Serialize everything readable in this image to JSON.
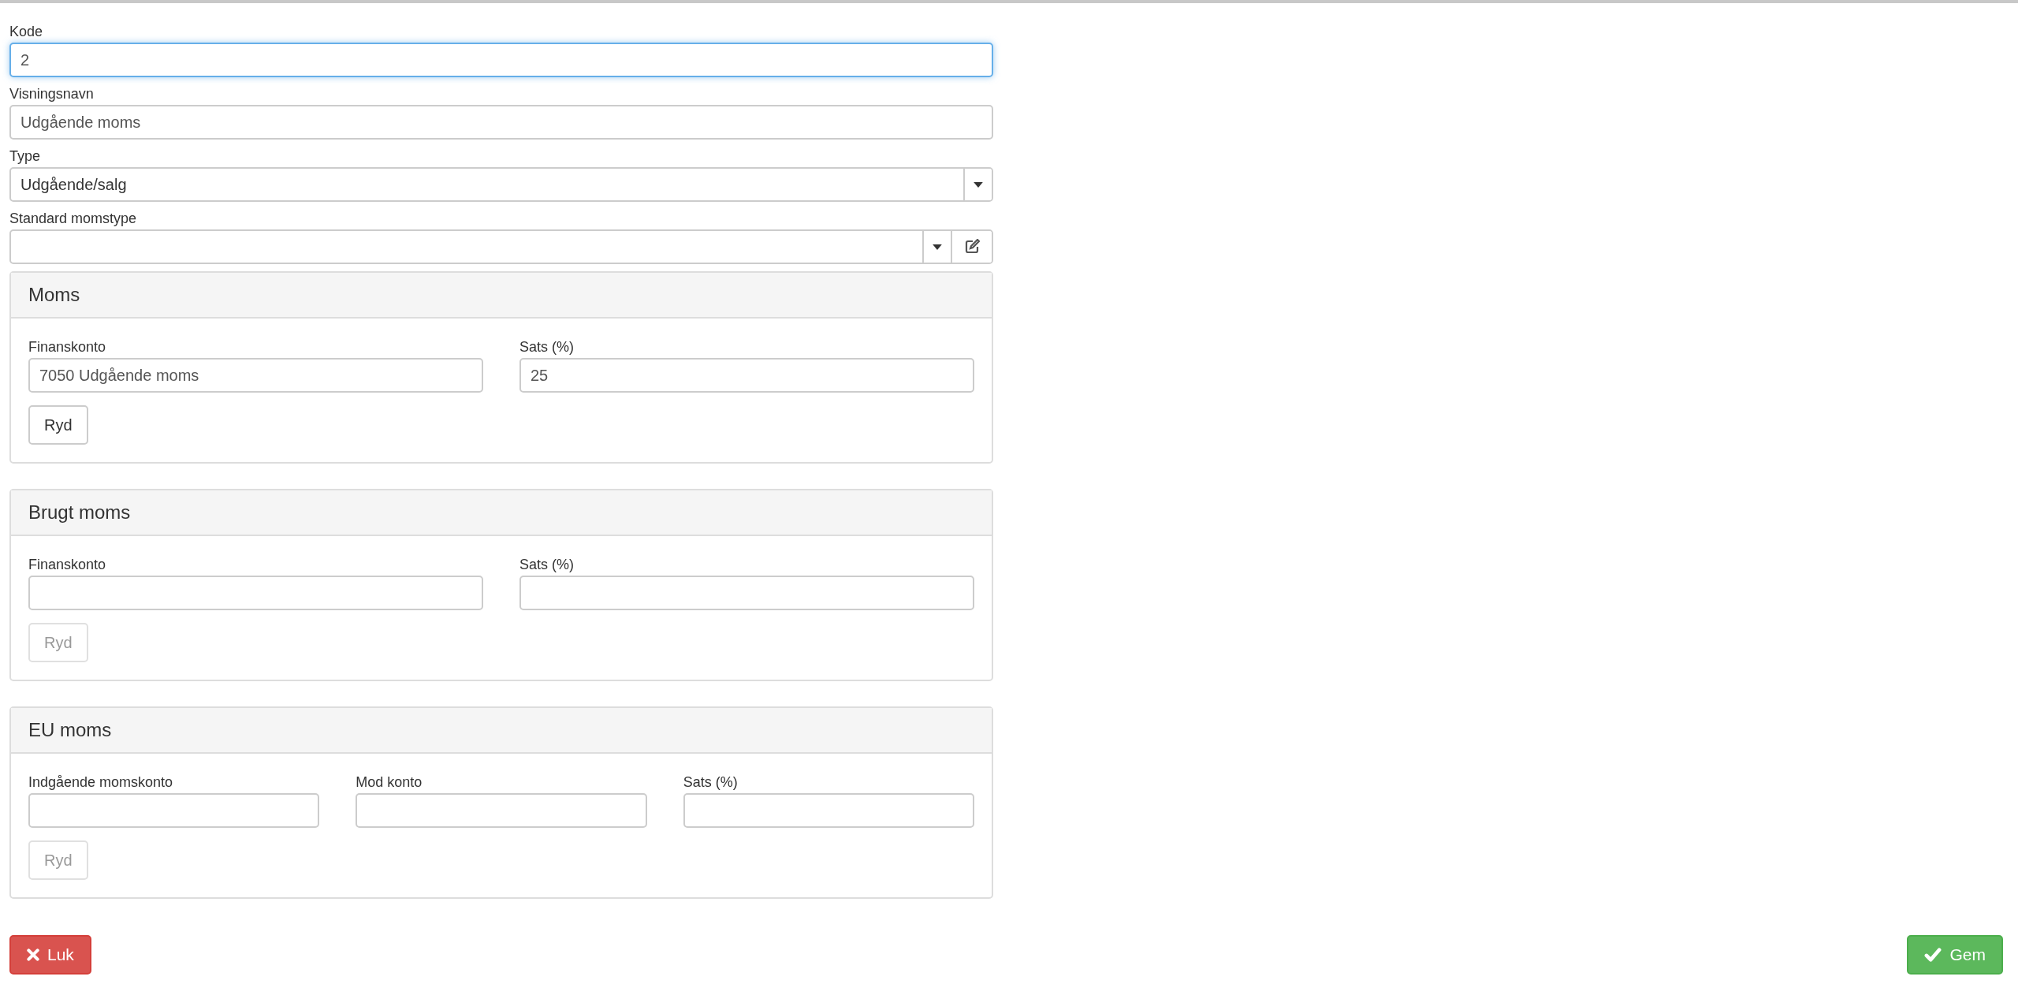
{
  "fields": [
    {
      "kind": "text",
      "label": "Kode",
      "value": "2",
      "focused": true
    },
    {
      "kind": "text",
      "label": "Visningsnavn",
      "value": "Udgående moms",
      "focused": false
    },
    {
      "kind": "select",
      "label": "Type",
      "value": "Udgående/salg",
      "focused": false
    },
    {
      "kind": "select-edit",
      "label": "Standard momstype",
      "focused": false
    }
  ],
  "panels": [
    {
      "title": "Moms",
      "fields": [
        {
          "label": "Finanskonto",
          "value": "7050 Udgående moms"
        },
        {
          "label": "Sats (%)",
          "value": "25"
        }
      ],
      "clear_button": {
        "label": "Ryd",
        "disabled": false
      }
    },
    {
      "title": "Brugt moms",
      "fields": [
        {
          "label": "Finanskonto"
        },
        {
          "label": "Sats (%)"
        }
      ],
      "clear_button": {
        "label": "Ryd",
        "disabled": true
      }
    },
    {
      "title": "EU moms",
      "fields": [
        {
          "label": "Indgående momskonto"
        },
        {
          "label": "Mod konto"
        },
        {
          "label": "Sats (%)"
        }
      ],
      "clear_button": {
        "label": "Ryd",
        "disabled": true
      }
    }
  ],
  "footer": {
    "close_button": {
      "label": "Luk"
    },
    "save_button": {
      "label": "Gem"
    }
  }
}
